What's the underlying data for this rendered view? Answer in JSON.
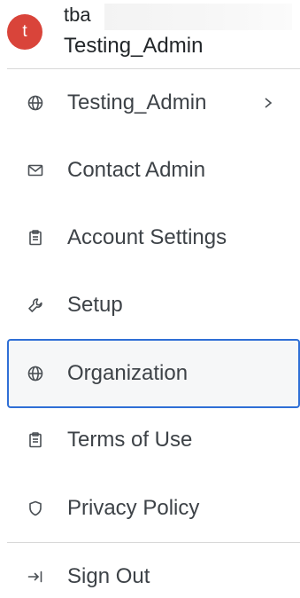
{
  "user": {
    "avatar_initial": "t",
    "name": "tba",
    "org": "Testing_Admin"
  },
  "menu": {
    "items": [
      {
        "label": "Testing_Admin",
        "icon": "globe-icon",
        "has_submenu": true
      },
      {
        "label": "Contact Admin",
        "icon": "mail-icon"
      },
      {
        "label": "Account Settings",
        "icon": "clipboard-icon"
      },
      {
        "label": "Setup",
        "icon": "wrench-icon"
      },
      {
        "label": "Organization",
        "icon": "globe-icon",
        "selected": true
      },
      {
        "label": "Terms of Use",
        "icon": "clipboard-icon"
      },
      {
        "label": "Privacy Policy",
        "icon": "shield-icon"
      }
    ],
    "sign_out": {
      "label": "Sign Out",
      "icon": "sign-out-icon"
    }
  },
  "colors": {
    "avatar": "#d9443a",
    "selected_border": "#2f6fd6",
    "text": "#3d4247",
    "divider": "#d8d8d8"
  }
}
